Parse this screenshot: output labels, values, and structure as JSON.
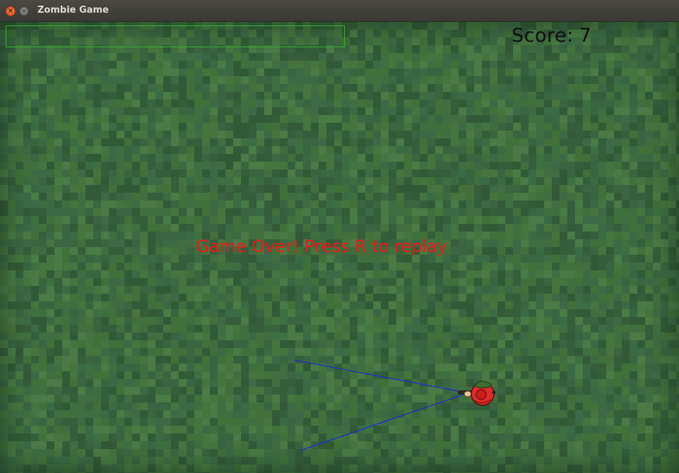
{
  "window": {
    "title": "Zombie Game"
  },
  "hud": {
    "score_label": "Score:",
    "score_value": "7",
    "health_bar_color": "#33b033"
  },
  "messages": {
    "game_over": "Game Over! Press R to replay"
  },
  "colors": {
    "grass_base": "#3d6a3f",
    "game_over_text": "#f01818",
    "score_text": "#111111",
    "aim_lines": "#1a2fd0",
    "player_body": "#e02a2a"
  }
}
